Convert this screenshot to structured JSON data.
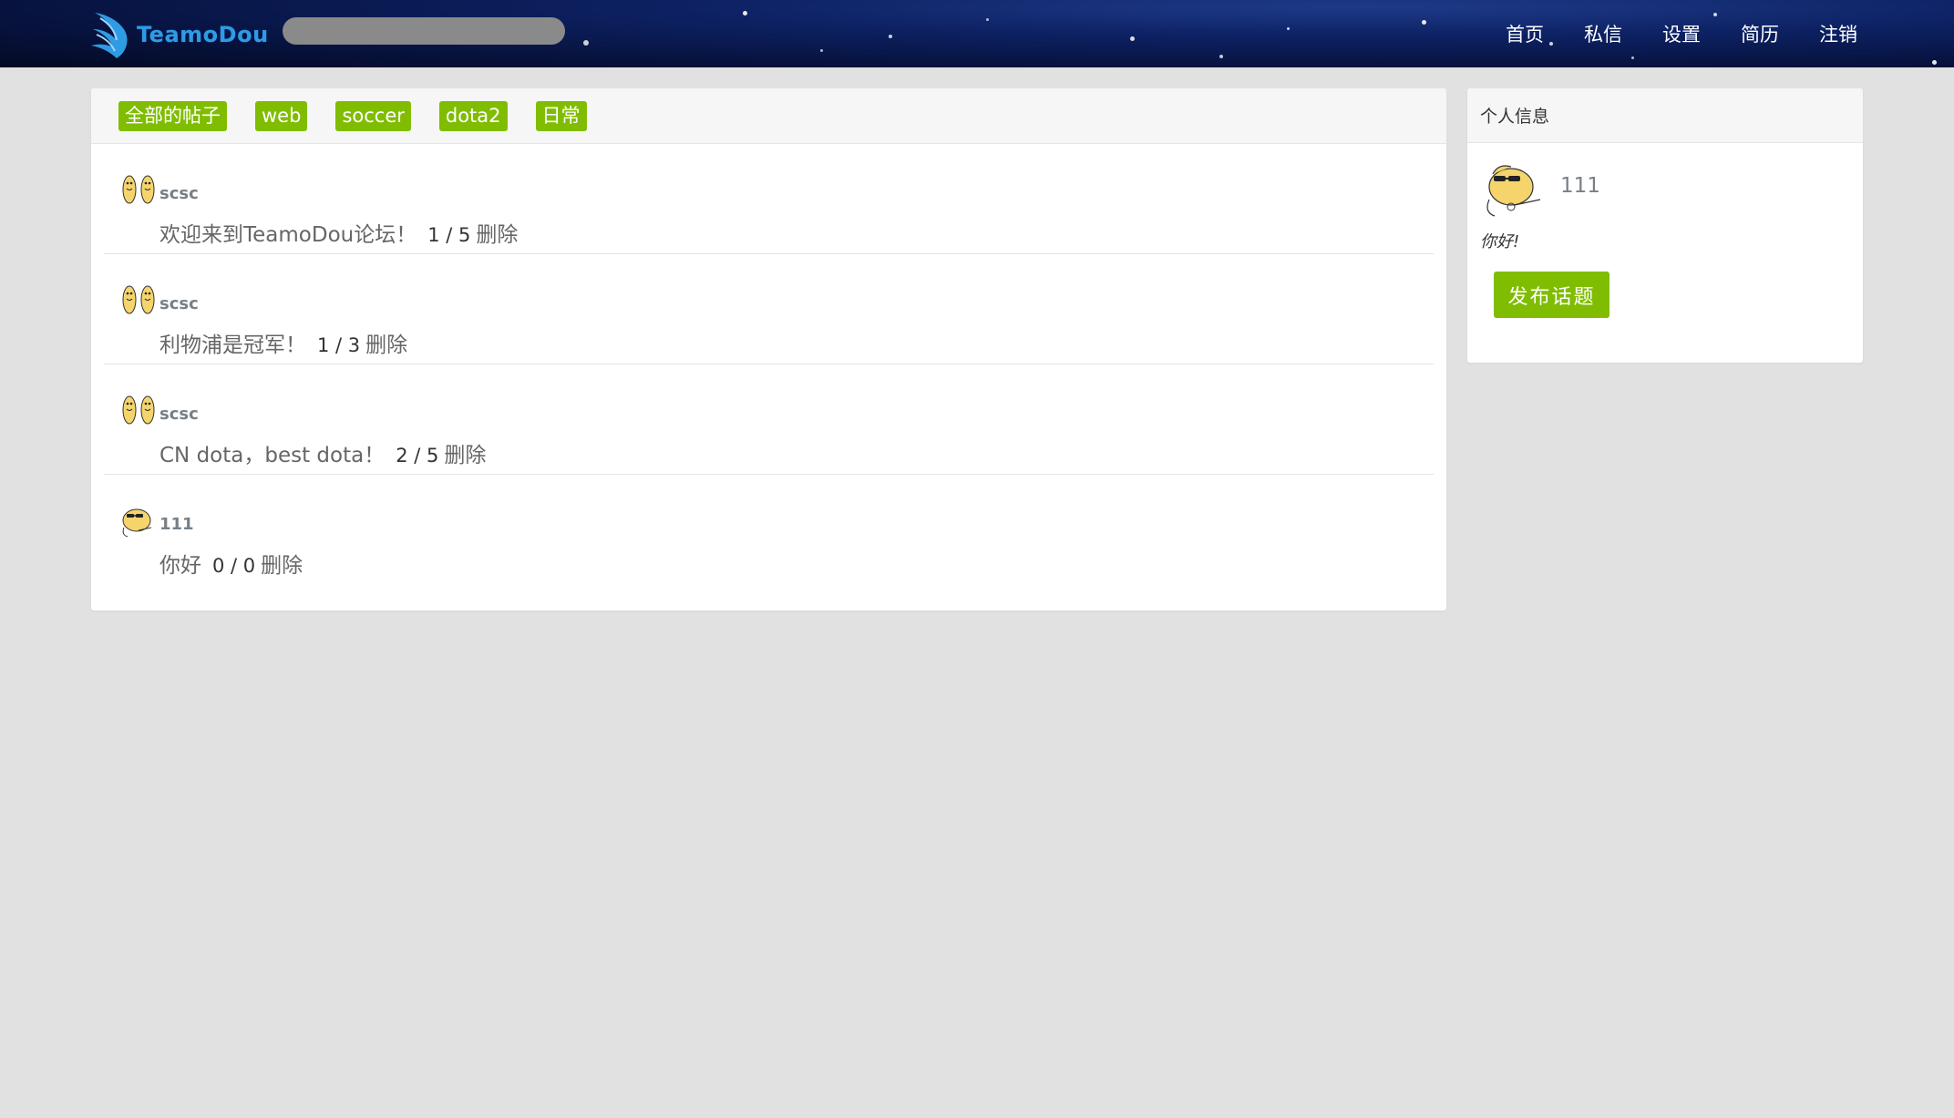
{
  "header": {
    "logo_text": "TeamoDou",
    "search": {
      "placeholder": "",
      "value": ""
    },
    "nav": [
      {
        "label": "首页"
      },
      {
        "label": "私信"
      },
      {
        "label": "设置"
      },
      {
        "label": "简历"
      },
      {
        "label": "注销"
      }
    ],
    "background_color": "#0d2163"
  },
  "main": {
    "tabs": [
      {
        "label": "全部的帖子"
      },
      {
        "label": "web"
      },
      {
        "label": "soccer"
      },
      {
        "label": "dota2"
      },
      {
        "label": "日常"
      }
    ],
    "topics": [
      {
        "author": "scsc",
        "avatar": "twin-figures-icon",
        "title": "欢迎来到TeamoDou论坛！",
        "count": "1 / 5",
        "delete_label": "删除"
      },
      {
        "author": "scsc",
        "avatar": "twin-figures-icon",
        "title": "利物浦是冠军！",
        "count": "1 / 3",
        "delete_label": "删除"
      },
      {
        "author": "scsc",
        "avatar": "twin-figures-icon",
        "title": "CN dota，best dota！",
        "count": "2 / 5",
        "delete_label": "删除"
      },
      {
        "author": "111",
        "avatar": "sunglasses-bird-icon",
        "title": "你好",
        "count": "0 / 0",
        "delete_label": "删除"
      }
    ]
  },
  "sidebar": {
    "header": "个人信息",
    "username": "111",
    "avatar": "sunglasses-bird-icon",
    "signature": "你好!",
    "post_button": "发布话题"
  },
  "colors": {
    "accent": "#80bd01",
    "page_background": "#e1e1e1",
    "panel_header": "#f6f6f6",
    "muted_text": "#778087"
  }
}
